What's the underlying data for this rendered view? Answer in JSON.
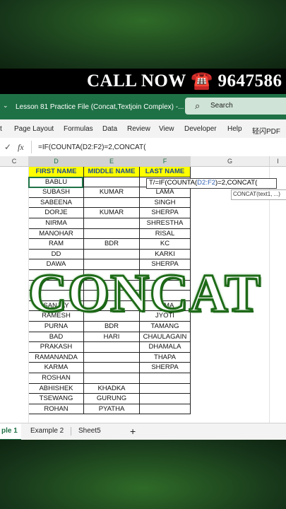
{
  "banner": {
    "call_text": "CALL NOW ☎️ 9647586"
  },
  "titlebar": {
    "chevron": "⌄",
    "file_name": "Lesson 81 Practice File (Concat,Textjoin Complex)  -...",
    "search_icon": "⌕",
    "search_label": "Search"
  },
  "ribbon": {
    "tabs": [
      "t",
      "Page Layout",
      "Formulas",
      "Data",
      "Review",
      "View",
      "Developer",
      "Help",
      "轻闪PDF"
    ]
  },
  "formula_bar": {
    "check": "✓",
    "fx": "fx",
    "formula": "=IF(COUNTA(D2:F2)=2,CONCAT("
  },
  "columns": [
    "C",
    "D",
    "E",
    "F",
    "G",
    "I"
  ],
  "table": {
    "headers": [
      "FIRST NAME",
      "MIDDLE NAME",
      "LAST NAME"
    ],
    "rows": [
      [
        "BABLU",
        "",
        ""
      ],
      [
        "SUBASH",
        "KUMAR",
        "LAMA"
      ],
      [
        "SABEENA",
        "",
        "SINGH"
      ],
      [
        "DORJE",
        "KUMAR",
        "SHERPA"
      ],
      [
        "NIRMA",
        "",
        "SHRESTHA"
      ],
      [
        "MANOHAR",
        "",
        "RISAL"
      ],
      [
        "RAM",
        "BDR",
        "KC"
      ],
      [
        "DD",
        "",
        "KARKI"
      ],
      [
        "DAWA",
        "",
        "SHERPA"
      ],
      [
        "",
        "",
        ""
      ],
      [
        "",
        "",
        ""
      ],
      [
        "",
        "",
        ""
      ],
      [
        "SANJAY",
        "",
        "LAMA"
      ],
      [
        "RAMESH",
        "",
        "JYOTI"
      ],
      [
        "PURNA",
        "BDR",
        "TAMANG"
      ],
      [
        "BAD",
        "HARI",
        "CHAULAGAIN"
      ],
      [
        "PRAKASH",
        "",
        "DHAMALA"
      ],
      [
        "RAMANANDA",
        "",
        "THAPA"
      ],
      [
        "KARMA",
        "",
        "SHERPA"
      ],
      [
        "ROSHAN",
        "",
        ""
      ],
      [
        "ABHISHEK",
        "KHADKA",
        ""
      ],
      [
        "TSEWANG",
        "GURUNG",
        ""
      ],
      [
        "ROHAN",
        "PYATHA",
        ""
      ]
    ]
  },
  "edit_cell": {
    "prefix": "T/=IF(COUNTA(",
    "ref": "D2:F2",
    "suffix": ")=2,CONCAT("
  },
  "tooltip": {
    "text": "CONCAT(text1, ...)"
  },
  "overlay": {
    "title": "CONCAT"
  },
  "sheet_tabs": {
    "tab1": "ple 1",
    "tab2": "Example 2",
    "tab3": "Sheet5",
    "add": "+"
  }
}
